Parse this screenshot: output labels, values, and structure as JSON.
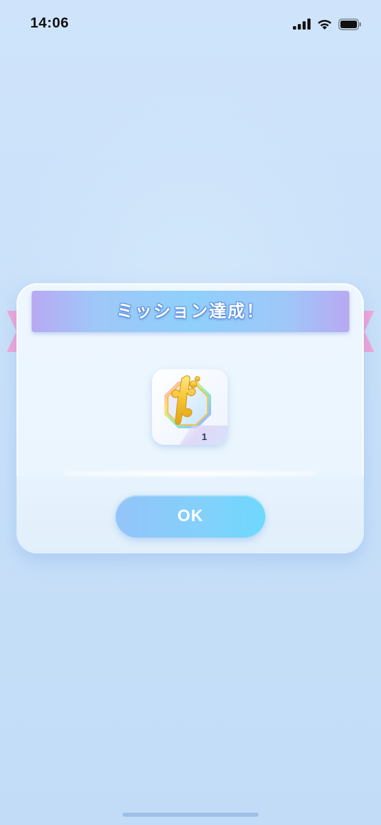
{
  "status_bar": {
    "time": "14:06",
    "icons": [
      "cellular-signal-icon",
      "wifi-icon",
      "battery-icon"
    ]
  },
  "dialog": {
    "title": "ミッション達成！",
    "reward": {
      "icon": "medal-icon",
      "count": "1"
    },
    "ok_label": "OK"
  },
  "colors": {
    "ribbon_pink": "#e990cf",
    "ribbon_blue": "#8fd0fb",
    "button_blue": "#82d1fb",
    "background": "#cfe4fa"
  }
}
